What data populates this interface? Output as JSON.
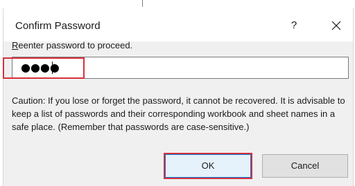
{
  "dialog": {
    "title": "Confirm Password",
    "help_label": "?",
    "close_icon": "close-icon"
  },
  "prompt": {
    "mnemonic": "R",
    "rest": "eenter password to proceed."
  },
  "password_field": {
    "value": "●●●●"
  },
  "caution_text": "Caution: If you lose or forget the password, it cannot be recovered. It is advisable to keep a list of passwords and their corresponding workbook and sheet names in a safe place.  (Remember that passwords are case-sensitive.)",
  "buttons": {
    "ok_label": "OK",
    "cancel_label": "Cancel"
  },
  "colors": {
    "highlight": "#d8303a",
    "accent": "#0078d7"
  }
}
